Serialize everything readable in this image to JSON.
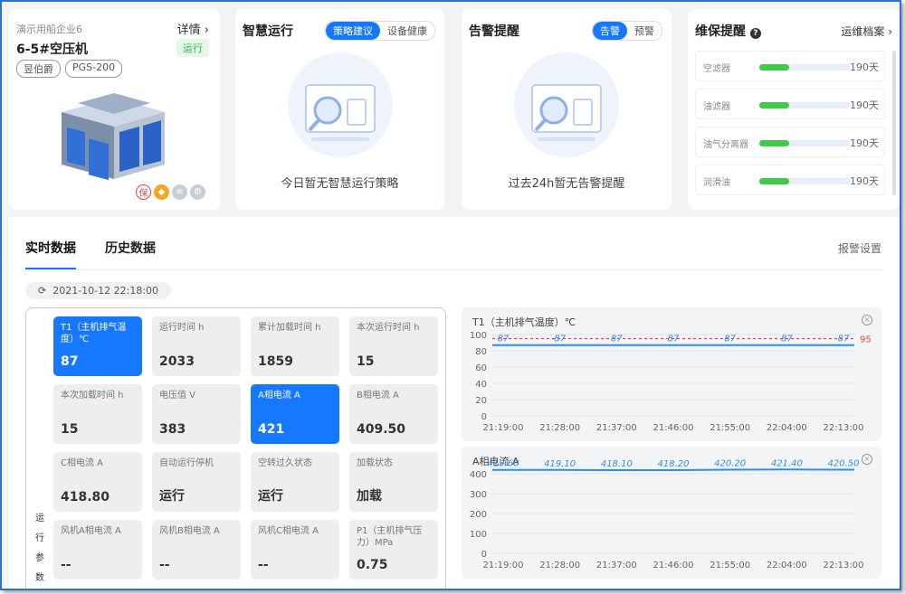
{
  "device": {
    "company": "演示用船企业6",
    "detail_label": "详情",
    "name": "6-5#空压机",
    "status": "运行",
    "tags": [
      "昱伯爵",
      "PGS-200"
    ]
  },
  "smart_ops": {
    "title": "智慧运行",
    "tabs": [
      "策略建议",
      "设备健康"
    ],
    "empty_text": "今日暂无智慧运行策略"
  },
  "alerts": {
    "title": "告警提醒",
    "tabs": [
      "告警",
      "预警"
    ],
    "empty_text": "过去24h暂无告警提醒"
  },
  "maintenance": {
    "title": "维保提醒",
    "archive_label": "运维档案",
    "items": [
      {
        "label": "空滤器",
        "value": "190天",
        "progress": 0.33
      },
      {
        "label": "油滤器",
        "value": "190天",
        "progress": 0.33
      },
      {
        "label": "油气分离器",
        "value": "190天",
        "progress": 0.33
      },
      {
        "label": "润滑油",
        "value": "190天",
        "progress": 0.33
      }
    ]
  },
  "main": {
    "tabs": [
      "实时数据",
      "历史数据"
    ],
    "alarm_settings": "报警设置",
    "timestamp": "2021-10-12 22:18:00",
    "section_label": "运行参数",
    "params": [
      {
        "name": "T1（主机排气温度）℃",
        "value": "87",
        "highlight": true
      },
      {
        "name": "运行时间 h",
        "value": "2033",
        "highlight": false
      },
      {
        "name": "累计加载时间 h",
        "value": "1859",
        "highlight": false
      },
      {
        "name": "本次运行时间 h",
        "value": "15",
        "highlight": false
      },
      {
        "name": "本次加载时间 h",
        "value": "15",
        "highlight": false
      },
      {
        "name": "电压值 V",
        "value": "383",
        "highlight": false
      },
      {
        "name": "A相电流 A",
        "value": "421",
        "highlight": true
      },
      {
        "name": "B相电流 A",
        "value": "409.50",
        "highlight": false
      },
      {
        "name": "C相电流 A",
        "value": "418.80",
        "highlight": false
      },
      {
        "name": "自动运行停机",
        "value": "运行",
        "highlight": false
      },
      {
        "name": "空转过久状态",
        "value": "运行",
        "highlight": false
      },
      {
        "name": "加载状态",
        "value": "加载",
        "highlight": false
      },
      {
        "name": "风机A相电流 A",
        "value": "--",
        "highlight": false
      },
      {
        "name": "风机B相电流 A",
        "value": "--",
        "highlight": false
      },
      {
        "name": "风机C相电流 A",
        "value": "--",
        "highlight": false
      },
      {
        "name": "P1（主机排气压力）MPa",
        "value": "0.75",
        "highlight": false
      }
    ]
  },
  "chart_data": [
    {
      "type": "line",
      "title": "T1（主机排气温度）℃",
      "x": [
        "21:19:00",
        "21:28:00",
        "21:37:00",
        "21:46:00",
        "21:55:00",
        "22:04:00",
        "22:13:00"
      ],
      "series": [
        {
          "values": [
            87,
            87,
            87,
            87,
            87,
            87,
            87
          ]
        }
      ],
      "threshold": 95,
      "ylim": [
        0,
        100
      ],
      "yticks": [
        0,
        20,
        40,
        60,
        80,
        100
      ],
      "colors": {
        "line": "#2d8cf0",
        "label": "#2d8cf0",
        "threshold": "#e84141"
      }
    },
    {
      "type": "line",
      "title": "A相电流 A",
      "x": [
        "21:19:00",
        "21:28:00",
        "21:37:00",
        "21:46:00",
        "21:55:00",
        "22:04:00",
        "22:13:00"
      ],
      "series": [
        {
          "values": [
            419.6,
            419.1,
            418.1,
            418.2,
            420.2,
            421.4,
            420.5
          ]
        }
      ],
      "labels": [
        "419.60",
        "419.10",
        "418.10",
        "418.20",
        "420.20",
        "421.40",
        "420.50"
      ],
      "ylim": [
        0,
        400
      ],
      "yticks": [
        0,
        100,
        200,
        300,
        400
      ],
      "colors": {
        "line": "#2d8cf0",
        "label": "#2d8cf0"
      }
    }
  ]
}
